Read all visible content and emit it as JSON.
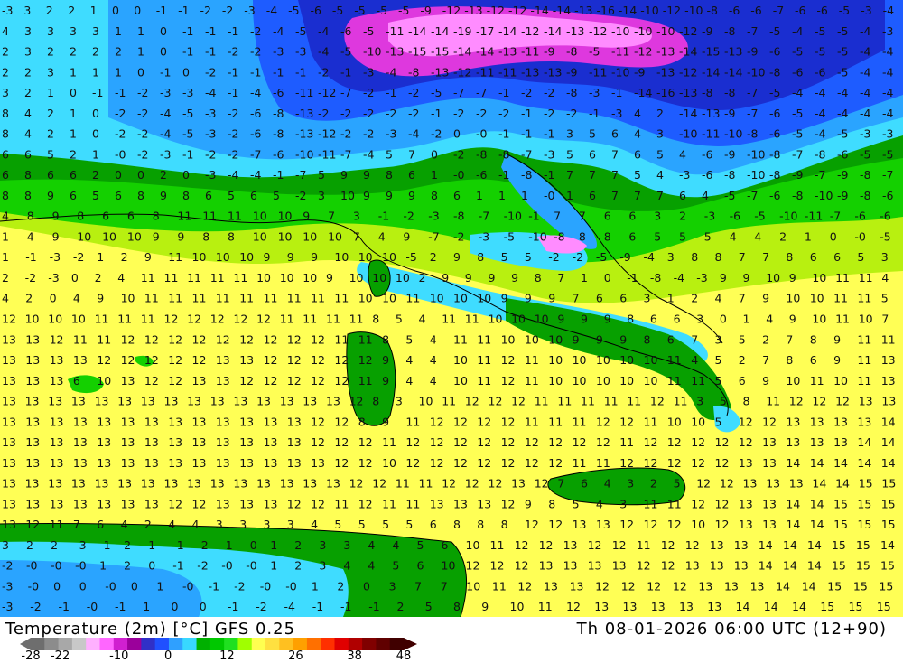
{
  "map": {
    "variable": "Temperature (2m) [°C]",
    "model": "GFS 0.25",
    "valid_time": "Th 08-01-2026 06:00 UTC (12+90)",
    "region": "Central Mediterranean / Italy"
  },
  "header_left": "Temperature (2m) [°C] GFS 0.25",
  "header_right": "Th 08-01-2026 06:00 UTC (12+90)",
  "legend": {
    "tick_labels": [
      "-28",
      "-22",
      "-10",
      "0",
      "12",
      "26",
      "38",
      "48"
    ],
    "colors": [
      "#6e6e6e",
      "#8c8c8c",
      "#a8a8a8",
      "#c8c8c8",
      "#ffb0ff",
      "#ff66ff",
      "#d020d0",
      "#9b009b",
      "#3030c8",
      "#2050ff",
      "#2fa0ff",
      "#38d8ff",
      "#00b000",
      "#00c800",
      "#20e020",
      "#a0ff00",
      "#ffff50",
      "#ffe040",
      "#ffc020",
      "#ffa000",
      "#ff7000",
      "#ff3000",
      "#e00000",
      "#b00000",
      "#800000",
      "#600000",
      "#400000"
    ]
  },
  "palette": {
    "dark_green": "#089b00",
    "green": "#00c400",
    "light_green": "#4fe30f",
    "lime": "#a8ef10",
    "yellow": "#ffff55",
    "cyan": "#3ce3ff",
    "light_blue": "#38b2ff",
    "blue": "#1e64ff",
    "dark_blue": "#1428c8",
    "magenta": "#e23ee2",
    "pink": "#ff88ff",
    "purple": "#b400b4",
    "coast": "#000000"
  },
  "grid_values": [
    "-3 3 2 2 1 0 0 -1 -1 -2 -2 -3 -4 -5 -6 -5 -5 -5 -5 -9 -12 -13 -12 -12 -14 -14 -13 -16 -14 -10 -12 -10 -8 -6 -6 -7 -6 -6 -5 -3 -4",
    "4 3 3 3 3 1 1 0 -1 -1 -1 -2 -4 -5 -4 -6 -5 -11 -14 -14 -19 -17 -14 -12 -14 -13 -12 -10 -10 -10 -12 -9 -8 -7 -5 -4 -5 -5 -4 -3",
    "2 3 2 2 2 2 1 0 -1 -1 -2 -2 -3 -3 -4 -5 -10 -13 -15 -15 -14 -14 -13 -11 -9 -8 -5 -11 -12 -13 -14 -15 -13 -9 -6 -5 -5 -5 -4 -4",
    "2 2 3 1 1 1 0 -1 0 -2 -1 -1 -1 -1 -2 -1 -3 -4 -8 -13 -12 -11 -11 -13 -13 -9 -11 -10 -9 -13 -12 -14 -14 -10 -8 -6 -6 -5 -4 -4",
    "3 2 1 0 -1 -1 -2 -3 -3 -4 -1 -4 -6 -11 -12 -7 -2 -1 -2 -5 -7 -7 -1 -2 -2 -8 -3 -1 -14 -16 -13 -8 -8 -7 -5 -4 -4 -4 -4 -4",
    "8 4 2 1 0 -2 -2 -4 -5 -3 -2 -6 -8 -13 -2 -2 -2 -2 -2 -1 -2 -2 -2 -1 -2 -2 -1 -3 4 2 -14 -13 -9 -7 -6 -5 -4 -4 -4 -4",
    "8 4 2 1 0 -2 -2 -4 -5 -3 -2 -6 -8 -13 -12 -2 -2 -3 -4 -2 0 -0 -1 -1 -1 3 5 6 4 3 -10 -11 -10 -8 -6 -5 -4 -5 -3 -3",
    "6 6 5 2 1 -0 -2 -3 -1 -2 -2 -7 -6 -10 -11 -7 -4 5 7 0 -2 -8 -8 -7 -3 5 6 7 6 5 4 -6 -9 -10 -8 -7 -8 -6 -5 -5",
    "6 8 6 6 2 0 0 2 0 -3 -4 -4 -1 -7 5 9 9 8 6 1 -0 -6 -1 -8 -1 7 7 7 5 4 -3 -6 -8 -10 -8 -9 -7 -9 -8 -7",
    "8 8 9 6 5 6 8 9 8 6 5 6 5 -2 3 10 9 9 9 8 6 1 1 1 -0 1 6 7 7 7 6 4 -5 -7 -6 -8 -10 -9 -8 -6",
    "4 8 9 8 6 6 8 11 11 11 10 10 9 7 3 -1 -2 -3 -8 -7 -10 -1 7 7 6 6 3 2 -3 -6 -5 -10 -11 -7 -6 -6",
    "1 4 9 10 10 10 9 9 8 8 10 10 10 10 7 4 9 -7 -2 -3 -5 -10 -8 8 8 6 5 5 5 4 4 2 1 0 -0 -5",
    "1 -1 -3 -2 1 2 9 11 10 10 10 9 9 9 10 10 10 -5 2 9 8 5 5 -2 -2 -5 -9 -4 3 8 8 7 7 8 6 6 5 3",
    "2 -2 -3 0 2 4 11 11 11 11 11 10 10 10 9 10 10 10 2 9 9 9 9 8 7 1 0 -1 -8 -4 -3 9 9 10 9 10 11 11 4",
    "4 2 0 4 9 10 11 11 11 11 11 11 11 11 11 10 10 11 10 10 10 9 9 9 7 6 6 3 1 2 4 7 9 10 10 11 11 5",
    "12 10 10 10 11 11 11 12 12 12 12 12 11 11 11 11 8 5 4 11 11 10 10 10 9 9 9 8 6 6 3 0 1 4 9 10 11 10 7",
    "13 13 12 11 11 12 12 12 12 12 12 12 12 12 11 11 8 5 4 11 11 10 10 10 9 9 9 8 6 7 3 5 2 7 8 9 11 11",
    "13 13 13 13 12 12 12 12 12 13 13 12 12 12 12 12 9 4 4 10 11 12 11 10 10 10 10 10 11 4 5 2 7 8 6 9 11 13",
    "13 13 13 6 10 13 12 12 13 13 12 12 12 12 12 11 9 4 4 10 11 12 11 10 10 10 10 10 11 11 5 6 9 10 11 10 11 13",
    "13 13 13 13 13 13 13 13 13 13 13 13 13 13 13 12 8 3 10 11 12 12 12 11 11 11 11 11 12 11 3 5 8 11 12 12 12 13 13",
    "13 13 13 13 13 13 13 13 13 13 13 13 13 12 12 8 9 11 12 12 12 12 11 11 11 12 12 11 10 10 5 12 12 13 13 13 13 14",
    "13 13 13 13 13 13 13 13 13 13 13 13 13 12 12 12 11 12 12 12 12 12 12 12 12 12 11 12 12 12 12 12 13 13 13 13 14 14",
    "13 13 13 13 13 13 13 13 13 13 13 13 13 13 12 12 10 12 12 12 12 12 12 12 11 11 12 12 12 12 12 13 13 14 14 14 14 14",
    "13 13 13 13 13 13 13 13 13 13 13 13 13 13 13 12 12 11 11 12 12 12 13 12 7 6 4 3 2 5 12 12 13 13 13 14 14 15 15",
    "13 13 13 13 13 13 13 12 12 13 13 13 12 12 11 12 11 11 13 13 13 12 9 8 5 4 3 11 11 12 12 13 13 14 14 15 15 15",
    "13 12 11 7 6 4 2 4 4 3 3 3 3 4 5 5 5 5 6 8 8 8 12 12 13 13 12 12 12 10 12 13 13 14 14 15 15 15",
    "3 2 2 -3 -1 2 1 -1 -2 -1 -0 1 2 3 3 4 4 5 6 10 11 12 12 13 12 12 11 12 12 13 13 14 14 14 15 15 14",
    "-2 -0 -0 -0 1 2 0 -1 -2 -0 -0 1 2 3 4 4 5 6 10 12 12 12 13 13 13 13 12 12 13 13 13 14 14 14 15 15 15",
    "-3 -0 0 0 -0 0 1 -0 -1 -2 -0 -0 1 2 0 3 7 7 10 11 12 13 13 12 12 12 12 13 13 13 14 14 15 15 15",
    "-3 -2 -1 -0 -1 1 0 0 -1 -2 -4 -1 -1 -1 2 5 8 9 10 11 12 13 13 13 13 13 14 14 14 15 15 15"
  ]
}
